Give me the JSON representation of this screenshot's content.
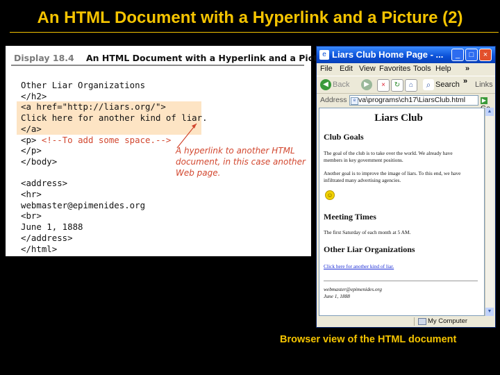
{
  "slide": {
    "title": "An HTML Document with a Hyperlink and a Picture (2)",
    "caption": "Browser view of the HTML document",
    "title_color": "#f5c400"
  },
  "code_panel": {
    "display_number": "Display 18.4",
    "display_title": "An HTML Document with a Hyperlink and a Picture",
    "lines": [
      "Other Liar Organizations",
      "</h2>",
      "<a href=\"http://liars.org/\">",
      "Click here for another kind of liar.",
      "</a>",
      "<p>",
      "</p>",
      "</body>",
      "",
      "<address>",
      "<hr>",
      "webmaster@epimenides.org",
      "<br>",
      "June 1, 1888",
      "</address>",
      "</html>"
    ],
    "comment": "<!--To add some space.-->",
    "annotation": "A hyperlink to another HTML document, in this case another Web page.",
    "highlight_color": "#fde4c4",
    "annotation_color": "#d2472f"
  },
  "browser": {
    "window_title": "Liars Club Home Page - ...",
    "window_icon": "ie-page-icon",
    "menu": [
      "File",
      "Edit",
      "View",
      "Favorites",
      "Tools",
      "Help"
    ],
    "menu_overflow": "»",
    "toolbar": {
      "back": "Back",
      "search": "Search",
      "links": "Links",
      "overflow": "»"
    },
    "address_label": "Address",
    "address_value": "va\\programs\\ch17\\LiarsClub.html",
    "go_label": "Go",
    "status_text": "My Computer",
    "page": {
      "heading": "Liars Club",
      "goals_heading": "Club Goals",
      "goals_p1_l1": "The goal of the club is to take over the world. We already have",
      "goals_p1_l2": "members in key government positions.",
      "goals_p2_l1": "Another goal is to improve the image of liars. To this end, we have",
      "goals_p2_l2": "infiltrated many advertising agencies.",
      "smiley": "smiley-face-icon",
      "meetings_heading": "Meeting Times",
      "meetings_text": "The first Saturday of each month at 5 AM.",
      "other_heading": "Other Liar Organizations",
      "link_text": "Click here for another kind of liar.",
      "email": "webmaster@epimenides.org",
      "date": "June 1, 1888"
    }
  }
}
